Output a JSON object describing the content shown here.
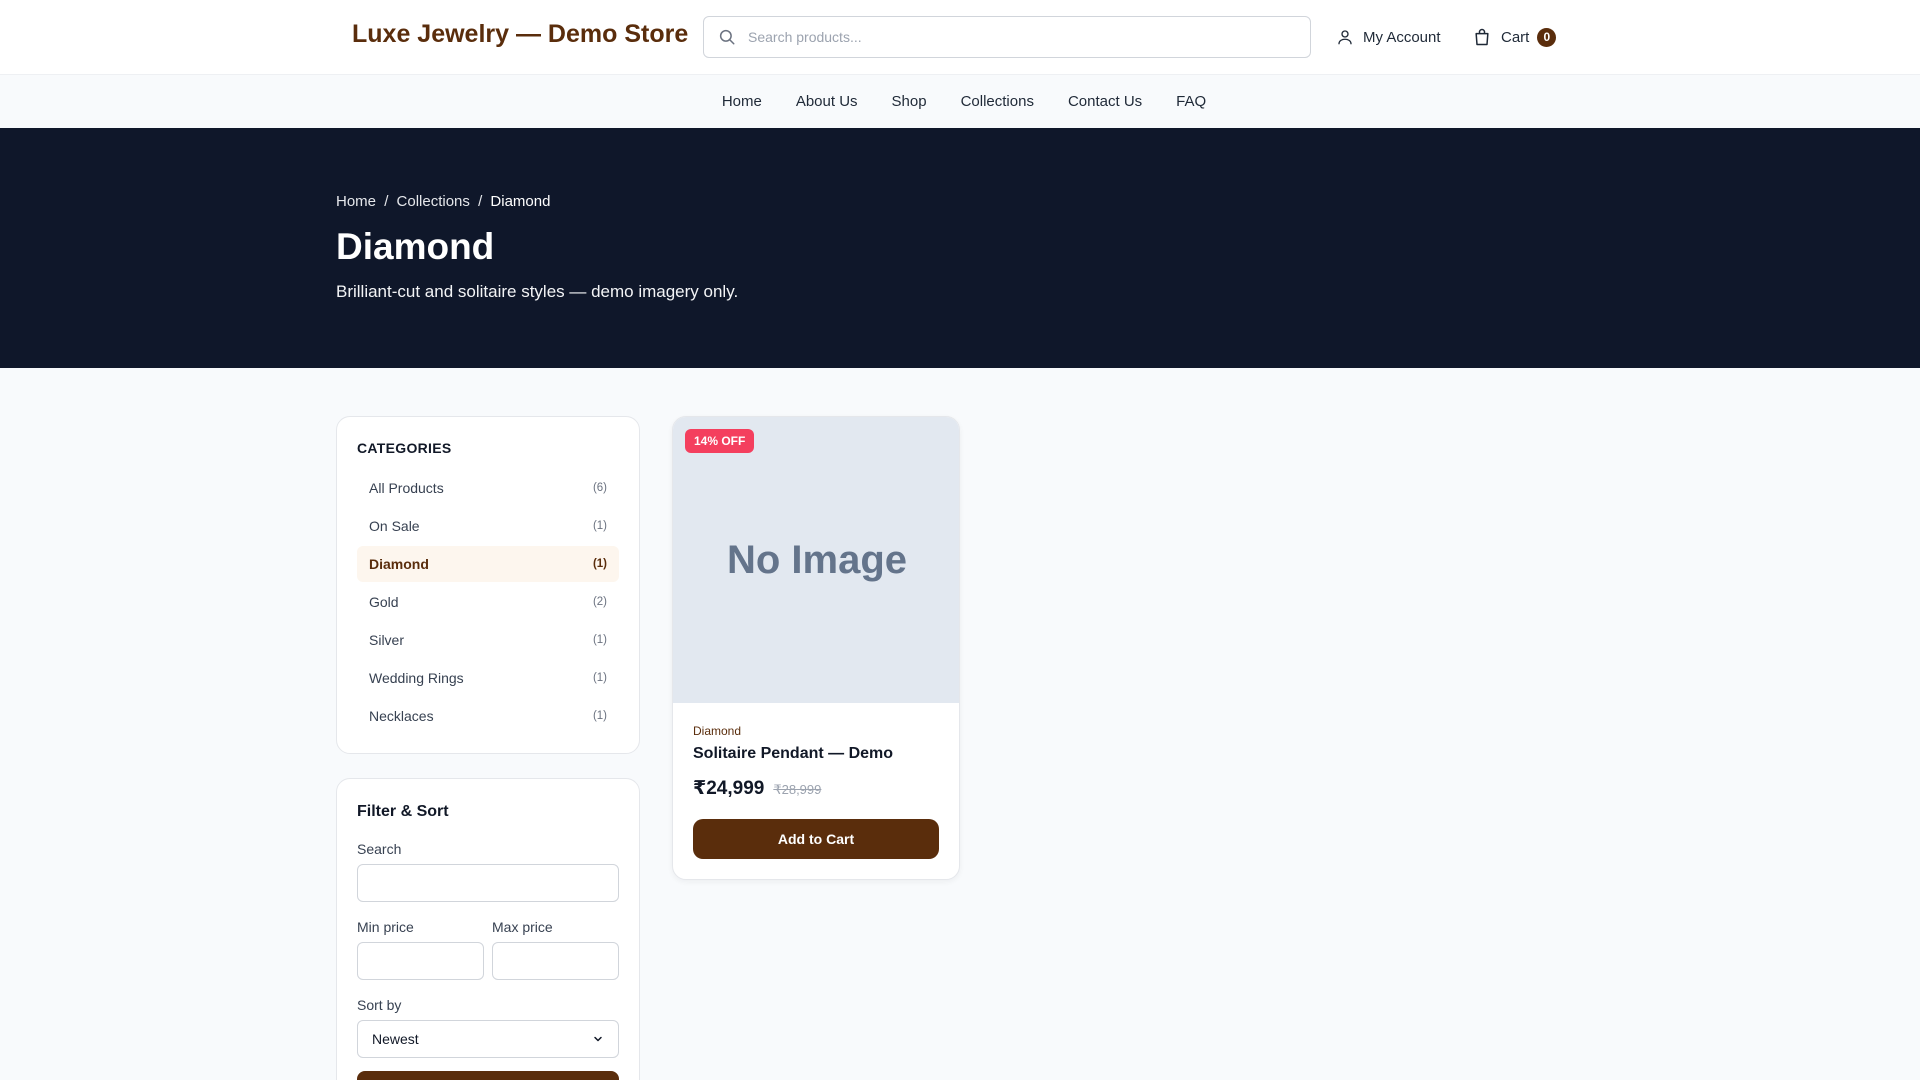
{
  "header": {
    "logo": "Luxe Jewelry — Demo Store",
    "search_placeholder": "Search products...",
    "account_label": "My Account",
    "cart_label": "Cart",
    "cart_count": "0",
    "brand_color": "#5a2d0c"
  },
  "nav": {
    "items": [
      "Home",
      "About Us",
      "Shop",
      "Collections",
      "Contact Us",
      "FAQ"
    ]
  },
  "hero": {
    "breadcrumb": [
      "Home",
      "Collections",
      "Diamond"
    ],
    "breadcrumb_sep": "/",
    "title": "Diamond",
    "subtitle": "Brilliant-cut and solitaire styles — demo imagery only.",
    "background_color": "#0f172a"
  },
  "categories": {
    "heading": "CATEGORIES",
    "items": [
      {
        "label": "All Products",
        "count": "(6)"
      },
      {
        "label": "On Sale",
        "count": "(1)"
      },
      {
        "label": "Diamond",
        "count": "(1)",
        "active": true
      },
      {
        "label": "Gold",
        "count": "(2)"
      },
      {
        "label": "Silver",
        "count": "(1)"
      },
      {
        "label": "Wedding Rings",
        "count": "(1)"
      },
      {
        "label": "Necklaces",
        "count": "(1)"
      }
    ]
  },
  "filters": {
    "title": "Filter & Sort",
    "search_label": "Search",
    "search_value": "",
    "min_price_label": "Min price",
    "min_price_value": "",
    "max_price_label": "Max price",
    "max_price_value": "",
    "sort_label": "Sort by",
    "sort_selected": "Newest"
  },
  "products": [
    {
      "badge": "14% OFF",
      "image_placeholder": "No Image",
      "category": "Diamond",
      "name": "Solitaire Pendant — Demo",
      "price": "₹24,999",
      "original_price": "₹28,999",
      "cta": "Add to Cart",
      "badge_color": "#f43f5e"
    }
  ]
}
